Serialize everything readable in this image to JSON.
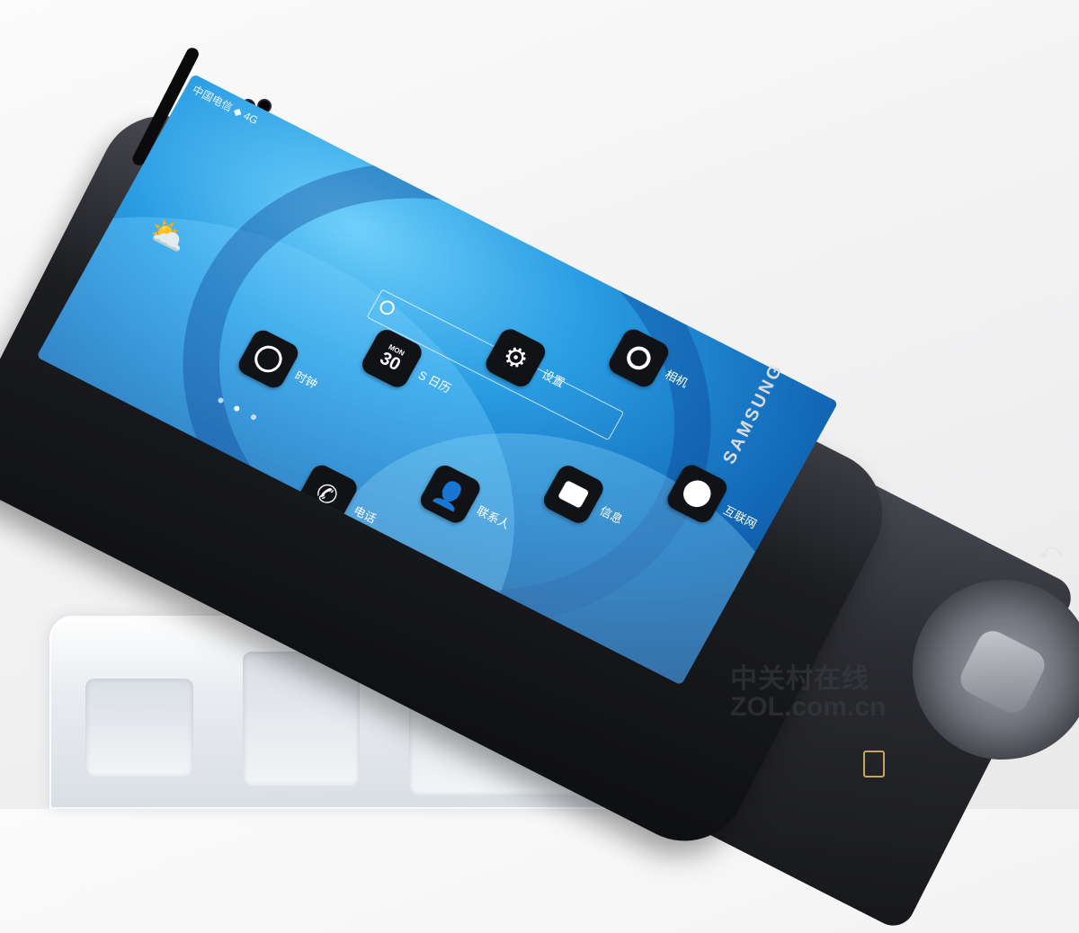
{
  "scene": {
    "background_color": "#f3f3f4",
    "phone_color": "#141518",
    "screen_accent": "#2a9de3"
  },
  "phone": {
    "brand": "SAMSUNG",
    "status_bar": "中国电信 ◆ 4G",
    "weather_icon": "partly-cloudy-icon",
    "apps": [
      {
        "id": "camera",
        "label": "相机",
        "icon": "camera-lens-icon"
      },
      {
        "id": "settings",
        "label": "设置",
        "icon": "gear-icon"
      },
      {
        "id": "calendar",
        "label": "S 日历",
        "icon": "calendar-icon",
        "day": "MON",
        "date": "30"
      },
      {
        "id": "clock",
        "label": "时钟",
        "icon": "clock-icon"
      },
      {
        "id": "browser",
        "label": "互联网",
        "icon": "globe-icon"
      },
      {
        "id": "messages",
        "label": "信息",
        "icon": "message-bubble-icon"
      },
      {
        "id": "contacts",
        "label": "联系人",
        "icon": "person-icon"
      },
      {
        "id": "phone",
        "label": "电话",
        "icon": "phone-handset-icon"
      }
    ]
  },
  "watermark": {
    "line1": "中关村在线",
    "line2": "ZOL.com.cn"
  }
}
